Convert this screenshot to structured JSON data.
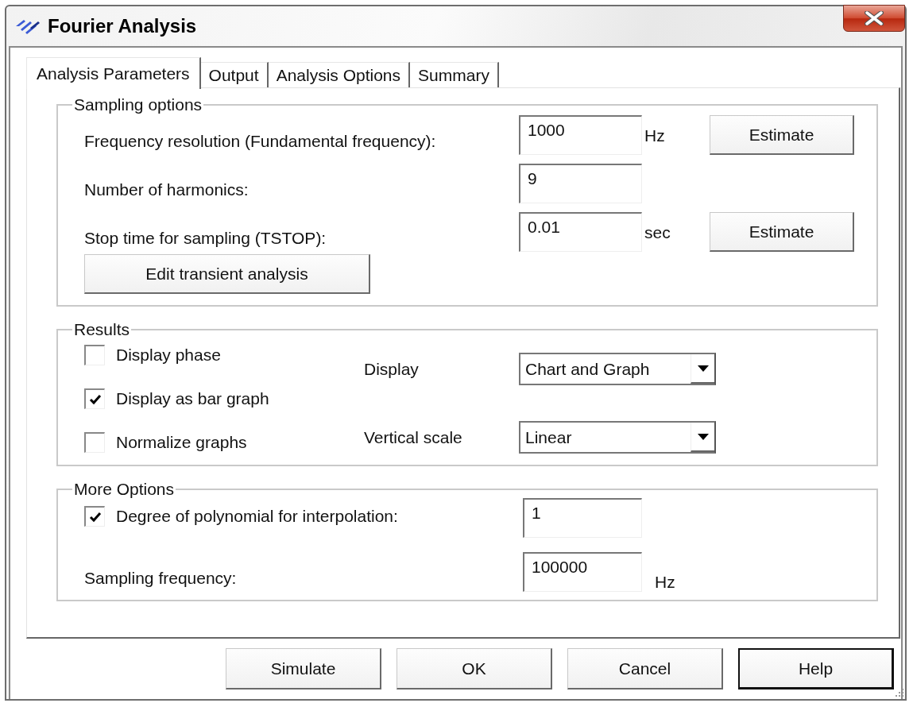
{
  "window": {
    "title": "Fourier Analysis"
  },
  "tabs": [
    {
      "label": "Analysis Parameters",
      "selected": true
    },
    {
      "label": "Output",
      "selected": false
    },
    {
      "label": "Analysis Options",
      "selected": false
    },
    {
      "label": "Summary",
      "selected": false
    }
  ],
  "sampling_options": {
    "title": "Sampling options",
    "rows": [
      {
        "label": "Frequency resolution (Fundamental frequency):",
        "value": "1000",
        "unit": "Hz",
        "button": "Estimate"
      },
      {
        "label": "Number of harmonics:",
        "value": "9"
      },
      {
        "label": "Stop time for sampling (TSTOP):",
        "value": "0.01",
        "unit": "sec",
        "button": "Estimate"
      }
    ],
    "edit_button": "Edit transient analysis"
  },
  "results": {
    "title": "Results",
    "checkboxes": [
      {
        "label": "Display phase",
        "checked": false
      },
      {
        "label": "Display as bar graph",
        "checked": true
      },
      {
        "label": "Normalize graphs",
        "checked": false
      }
    ],
    "dropdowns": [
      {
        "label": "Display",
        "value": "Chart and Graph"
      },
      {
        "label": "Vertical scale",
        "value": "Linear"
      }
    ]
  },
  "more_options": {
    "title": "More Options",
    "rows": [
      {
        "kind": "checkbox",
        "label": "Degree of polynomial for interpolation:",
        "checked": true,
        "value": "1"
      },
      {
        "kind": "plain",
        "label": "Sampling frequency:",
        "value": "100000",
        "unit": "Hz"
      }
    ]
  },
  "buttons": [
    {
      "label": "Simulate",
      "default": false
    },
    {
      "label": "OK",
      "default": false
    },
    {
      "label": "Cancel",
      "default": false
    },
    {
      "label": "Help",
      "default": true
    }
  ]
}
